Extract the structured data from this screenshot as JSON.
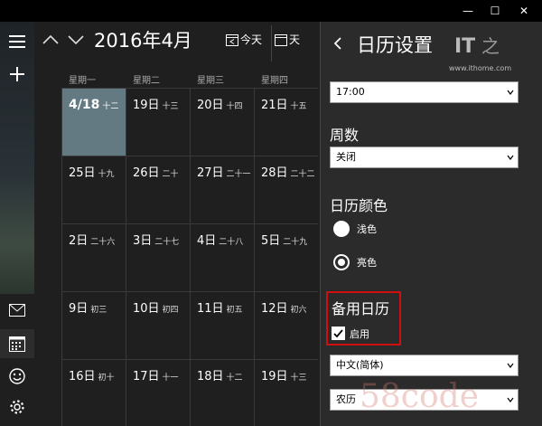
{
  "window": {
    "minimize_label": "—",
    "maximize_label": "☐",
    "close_label": "✕"
  },
  "header": {
    "month_title": "2016年4月",
    "today_label": "今天",
    "day_label": "天"
  },
  "weekdays": [
    "星期一",
    "星期二",
    "星期三",
    "星期四"
  ],
  "weeks": [
    [
      {
        "day": "4/18",
        "lunar": "十二",
        "today": true
      },
      {
        "day": "19日",
        "lunar": "十三"
      },
      {
        "day": "20日",
        "lunar": "十四"
      },
      {
        "day": "21日",
        "lunar": "十五"
      }
    ],
    [
      {
        "day": "25日",
        "lunar": "十九"
      },
      {
        "day": "26日",
        "lunar": "二十"
      },
      {
        "day": "27日",
        "lunar": "二十一"
      },
      {
        "day": "28日",
        "lunar": "二十二"
      }
    ],
    [
      {
        "day": "2日",
        "lunar": "二十六"
      },
      {
        "day": "3日",
        "lunar": "二十七"
      },
      {
        "day": "4日",
        "lunar": "二十八"
      },
      {
        "day": "5日",
        "lunar": "二十九"
      }
    ],
    [
      {
        "day": "9日",
        "lunar": "初三"
      },
      {
        "day": "10日",
        "lunar": "初四"
      },
      {
        "day": "11日",
        "lunar": "初五"
      },
      {
        "day": "12日",
        "lunar": "初六"
      }
    ],
    [
      {
        "day": "16日",
        "lunar": "初十"
      },
      {
        "day": "17日",
        "lunar": "十一"
      },
      {
        "day": "18日",
        "lunar": "十二"
      },
      {
        "day": "19日",
        "lunar": "十三"
      }
    ]
  ],
  "settings": {
    "title": "日历设置",
    "logo_text": "IT之家",
    "site_url": "www.ithome.com",
    "time_value": "17:00",
    "week_label": "周数",
    "week_value": "关闭",
    "color_label": "日历颜色",
    "light_label": "浅色",
    "dark_label": "亮色",
    "dark_selected": true,
    "alt_label": "备用日历",
    "alt_enable_label": "启用",
    "alt_enabled": true,
    "language_value": "中文(简体)",
    "calendar_type_value": "农历",
    "highlight_color": "#d01010"
  },
  "watermark": "58code"
}
